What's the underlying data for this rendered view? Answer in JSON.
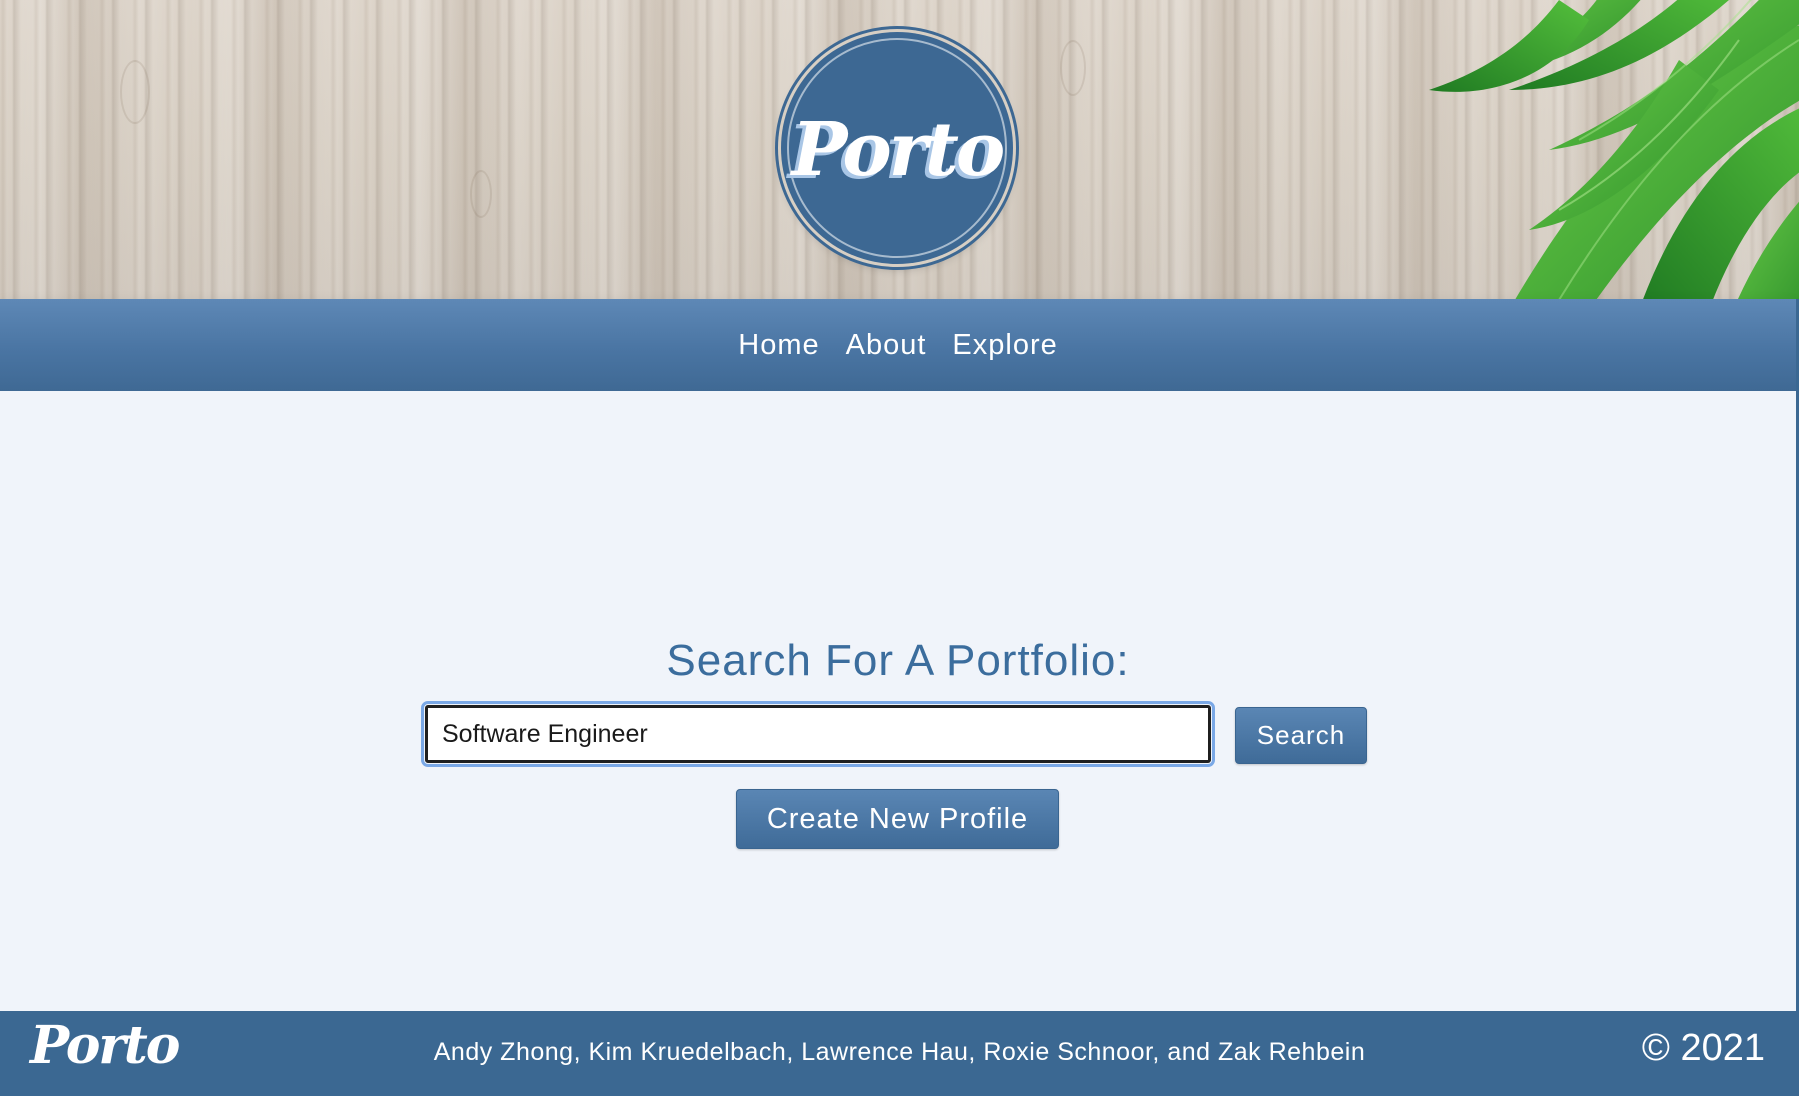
{
  "brand": {
    "logo_text": "Porto"
  },
  "nav": {
    "items": [
      {
        "label": "Home"
      },
      {
        "label": "About"
      },
      {
        "label": "Explore"
      }
    ]
  },
  "search": {
    "heading": "Search For A Portfolio:",
    "input_value": "Software Engineer",
    "button_label": "Search"
  },
  "create_profile": {
    "button_label": "Create New Profile"
  },
  "footer": {
    "logo_text": "Porto",
    "credits": "Andy Zhong, Kim Kruedelbach, Lawrence Hau, Roxie Schnoor, and Zak Rehbein",
    "copyright": "© 2021"
  },
  "colors": {
    "primary": "#3b6892",
    "nav_top": "#5e88b6",
    "heading": "#3b6d9d",
    "page_bg": "#f0f4fa",
    "leaf_green": "#3fa535"
  }
}
